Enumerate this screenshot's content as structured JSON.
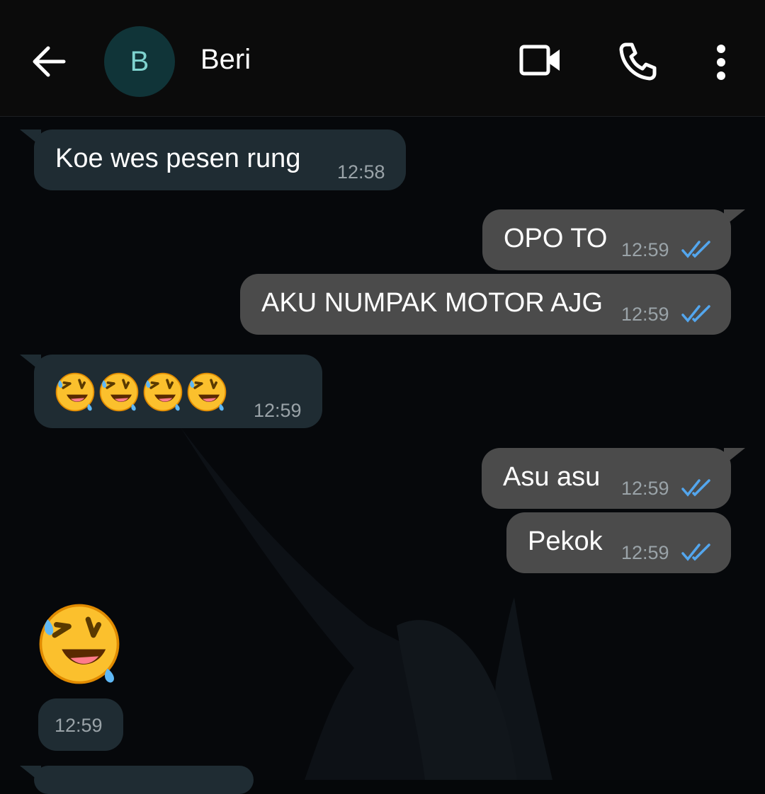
{
  "header": {
    "contact_initial": "B",
    "contact_name": "Beri"
  },
  "icons": {
    "back": "arrow-left-icon",
    "video": "video-camera-icon",
    "call": "phone-icon",
    "menu": "more-vertical-icon",
    "read_receipt": "double-check-icon"
  },
  "colors": {
    "incoming_bubble": "#1f2c33",
    "outgoing_bubble": "#4b4b4b",
    "read_tick": "#53a6ee",
    "avatar_bg": "#103438"
  },
  "messages": [
    {
      "direction": "incoming",
      "text": "Koe wes pesen rung",
      "time": "12:58"
    },
    {
      "direction": "outgoing",
      "text": "OPO TO",
      "time": "12:59",
      "status": "read"
    },
    {
      "direction": "outgoing",
      "text": "AKU NUMPAK MOTOR AJG",
      "time": "12:59",
      "status": "read"
    },
    {
      "direction": "incoming",
      "text": "🤣🤣🤣🤣",
      "time": "12:59"
    },
    {
      "direction": "outgoing",
      "text": "Asu asu",
      "time": "12:59",
      "status": "read"
    },
    {
      "direction": "outgoing",
      "text": "Pekok",
      "time": "12:59",
      "status": "read"
    },
    {
      "direction": "incoming",
      "text": "🤣",
      "time": "12:59",
      "type": "big-emoji"
    }
  ]
}
